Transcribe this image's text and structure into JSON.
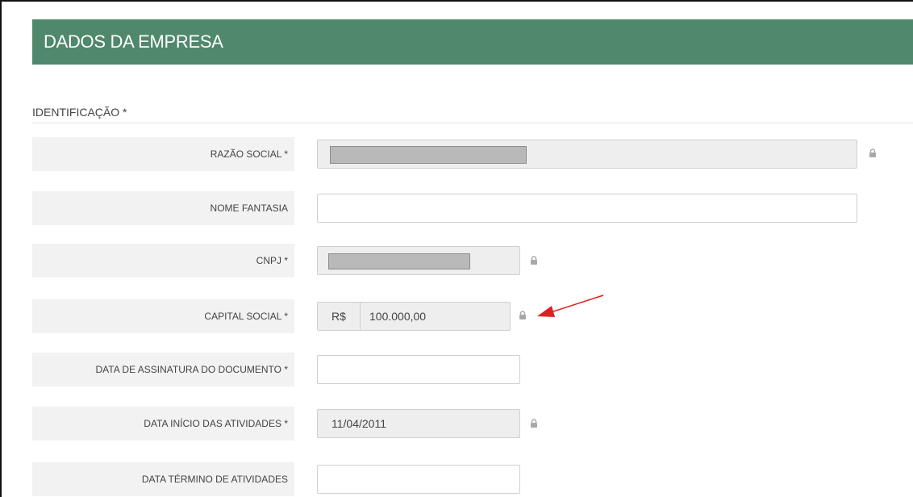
{
  "header": {
    "title": "DADOS DA EMPRESA"
  },
  "section": {
    "label": "IDENTIFICAÇÃO *"
  },
  "fields": {
    "razao_social": {
      "label": "RAZÃO SOCIAL *",
      "value": ""
    },
    "nome_fantasia": {
      "label": "NOME FANTASIA",
      "value": ""
    },
    "cnpj": {
      "label": "CNPJ *",
      "value": ""
    },
    "capital_social": {
      "label": "CAPITAL SOCIAL *",
      "prefix": "R$",
      "value": "100.000,00"
    },
    "data_assinatura": {
      "label": "DATA DE ASSINATURA DO DOCUMENTO *",
      "value": ""
    },
    "data_inicio": {
      "label": "DATA INÍCIO DAS ATIVIDADES *",
      "value": "11/04/2011"
    },
    "data_termino": {
      "label": "DATA TÉRMINO DE ATIVIDADES",
      "value": ""
    }
  },
  "icons": {
    "lock": "lock-icon",
    "annotation": "red-arrow-icon"
  },
  "colors": {
    "header_bg": "#4f886b",
    "label_bg": "#f2f2f2",
    "disabled_bg": "#eeeeee",
    "arrow": "#e02020"
  }
}
